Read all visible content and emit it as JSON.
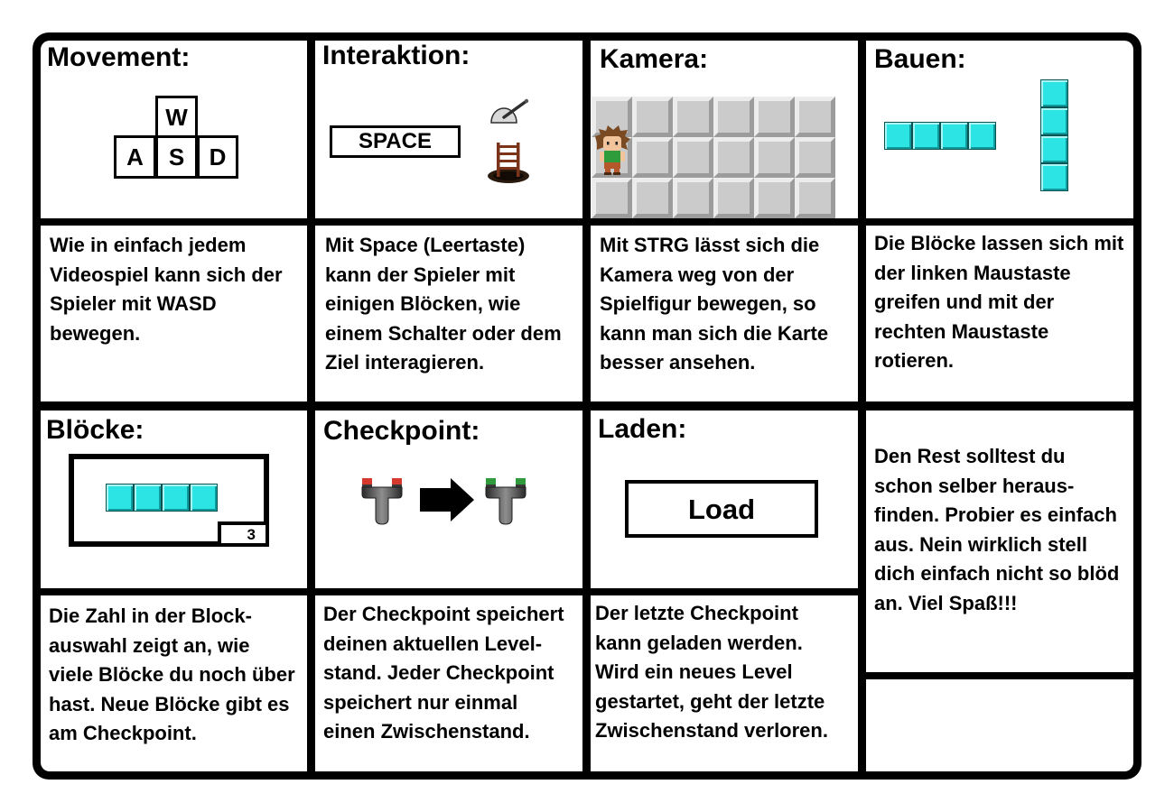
{
  "panels": {
    "movement": {
      "title": "Movement:",
      "keys": {
        "w": "W",
        "a": "A",
        "s": "S",
        "d": "D"
      },
      "text": [
        "Wie in einfach jedem",
        "Videospiel kann sich der",
        "Spieler mit WASD",
        "bewegen."
      ]
    },
    "interaction": {
      "title": "Interaktion:",
      "key": "SPACE",
      "icons": [
        "lever-icon",
        "ladder-hole-icon"
      ],
      "text": [
        "Mit Space (Leertaste)",
        "kann der Spieler mit",
        "einigen Blöcken, wie",
        "einem Schalter oder dem",
        "Ziel interagieren."
      ]
    },
    "camera": {
      "title": "Kamera:",
      "icons": [
        "floor-tile-icon",
        "player-character-icon"
      ],
      "text": [
        "Mit STRG lässt sich die",
        "Kamera weg von der",
        "Spielfigur bewegen, so",
        "kann man sich die Karte",
        "besser ansehen."
      ]
    },
    "building": {
      "title": "Bauen:",
      "icons": [
        "horizontal-block-piece-icon",
        "vertical-block-piece-icon"
      ],
      "text": [
        "Die Blöcke lassen sich mit",
        "der linken Maustaste",
        "greifen und mit der",
        "rechten Maustaste",
        "rotieren."
      ]
    },
    "blocks": {
      "title": "Blöcke:",
      "icons": [
        "block-selection-slot-icon"
      ],
      "block_count": "3",
      "text": [
        "Die Zahl in der Block-",
        "auswahl zeigt an, wie",
        "viele Blöcke du noch über",
        "hast. Neue Blöcke gibt es",
        "am Checkpoint."
      ]
    },
    "checkpoint": {
      "title": "Checkpoint:",
      "icons": [
        "checkpoint-inactive-icon",
        "arrow-right-icon",
        "checkpoint-active-icon"
      ],
      "text": [
        "Der Checkpoint speichert",
        "deinen aktuellen Level-",
        "stand. Jeder Checkpoint",
        "speichert nur einmal",
        "einen Zwischenstand."
      ]
    },
    "load": {
      "title": "Laden:",
      "button_label": "Load",
      "text": [
        "Der letzte Checkpoint",
        "kann geladen werden.",
        "Wird ein neues Level",
        "gestartet, geht der letzte",
        "Zwischenstand verloren."
      ]
    },
    "rest": {
      "text": [
        "Den Rest solltest du",
        "schon selber heraus-",
        "finden. Probier es einfach",
        "aus. Nein wirklich stell",
        "dich einfach nicht so blöd",
        "an. Viel Spaß!!!"
      ]
    }
  },
  "colors": {
    "frame": "#000000",
    "cell_background": "#ffffff",
    "block_fill": "#2de4e4",
    "block_edge": "#0f9b9b",
    "block_outline": "#0b5252",
    "floor_tile": "#cbcbcb",
    "checkpoint_inactive_cap": "#d63a2e",
    "checkpoint_active_cap": "#2f9a3b",
    "checkpoint_body": "#3a3a3a",
    "ladder": "#7b3419",
    "character_hair": "#7a4a22",
    "character_shirt": "#2e9c3a",
    "character_pants": "#b4572b"
  }
}
